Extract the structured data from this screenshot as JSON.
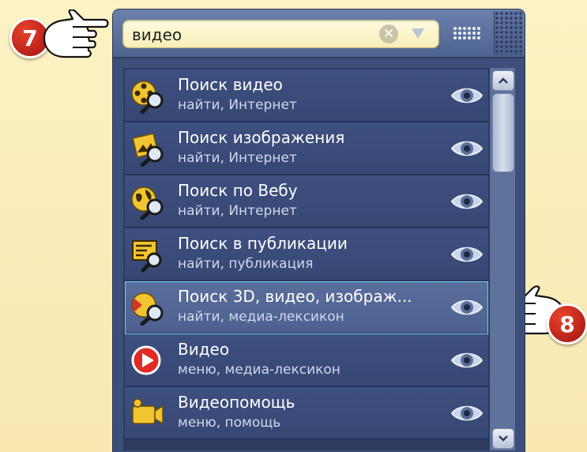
{
  "callouts": {
    "first": "7",
    "second": "8"
  },
  "search": {
    "value": "видео",
    "clear_glyph": "✕"
  },
  "results": [
    {
      "title": "Поиск видео",
      "subtitle": "найти, Интернет",
      "icon": "film-search-icon"
    },
    {
      "title": "Поиск изображения",
      "subtitle": "найти, Интернет",
      "icon": "image-search-icon"
    },
    {
      "title": "Поиск по Вебу",
      "subtitle": "найти, Интернет",
      "icon": "globe-search-icon"
    },
    {
      "title": "Поиск в публикации",
      "subtitle": "найти, публикация",
      "icon": "publication-search-icon"
    },
    {
      "title": "Поиск 3D, видео, изображ...",
      "subtitle": "найти, медиа-лексикон",
      "icon": "media-search-icon",
      "selected": true
    },
    {
      "title": "Видео",
      "subtitle": "меню, медиа-лексикон",
      "icon": "video-play-icon"
    },
    {
      "title": "Видеопомощь",
      "subtitle": "меню, помощь",
      "icon": "video-camera-icon"
    }
  ],
  "colors": {
    "background": "#fdf2c4",
    "panel": "#3d4f78",
    "item": "#3e5080",
    "selected_outline": "#6fd4e6",
    "callout_red": "#c0241a"
  }
}
